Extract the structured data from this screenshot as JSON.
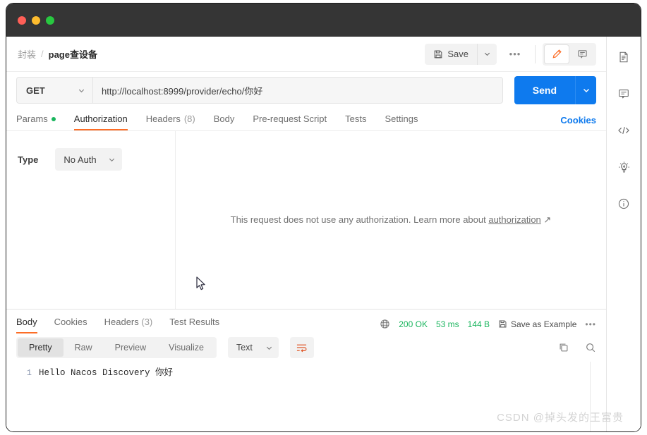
{
  "window": {
    "traffic_lights": [
      "close",
      "minimize",
      "maximize"
    ],
    "titlebar_color": "#353535"
  },
  "colors": {
    "accent_orange": "#fc6d26",
    "send_blue": "#0e7aee",
    "link_blue": "#0e7aee",
    "success_green": "#19b55d"
  },
  "breadcrumb": {
    "parent": "封装",
    "separator": "/",
    "current": "page查设备"
  },
  "header": {
    "save_label": "Save",
    "save_caret_icon": "chevron-down-icon",
    "more_label": "•••",
    "edit_icon": "pencil-icon",
    "comment_icon": "comment-icon"
  },
  "request": {
    "method": "GET",
    "method_caret_icon": "chevron-down-icon",
    "url": "http://localhost:8999/provider/echo/你好",
    "url_placeholder": "Enter request URL",
    "send_label": "Send",
    "send_caret_icon": "chevron-down-icon"
  },
  "request_tabs": [
    {
      "label": "Params",
      "dot": true,
      "active": false
    },
    {
      "label": "Authorization",
      "dot": false,
      "active": true
    },
    {
      "label": "Headers",
      "count": "(8)",
      "dot": false,
      "active": false
    },
    {
      "label": "Body",
      "dot": false,
      "active": false
    },
    {
      "label": "Pre-request Script",
      "dot": false,
      "active": false
    },
    {
      "label": "Tests",
      "dot": false,
      "active": false
    },
    {
      "label": "Settings",
      "dot": false,
      "active": false
    }
  ],
  "cookies_link": "Cookies",
  "authorization": {
    "type_label": "Type",
    "type_value": "No Auth",
    "type_caret_icon": "chevron-down-icon",
    "message_prefix": "This request does not use any authorization. Learn more about ",
    "message_link": "authorization",
    "message_link_icon": "external-link-arrow-icon"
  },
  "response": {
    "tabs": [
      {
        "label": "Body",
        "active": true
      },
      {
        "label": "Cookies",
        "active": false
      },
      {
        "label": "Headers",
        "count": "(3)",
        "active": false
      },
      {
        "label": "Test Results",
        "active": false
      }
    ],
    "globe_icon": "globe-icon",
    "status": "200 OK",
    "time": "53 ms",
    "size": "144 B",
    "save_example_label": "Save as Example",
    "save_example_icon": "save-icon",
    "more_label": "•••",
    "format_tabs": [
      {
        "label": "Pretty",
        "active": true
      },
      {
        "label": "Raw",
        "active": false
      },
      {
        "label": "Preview",
        "active": false
      },
      {
        "label": "Visualize",
        "active": false
      }
    ],
    "language": "Text",
    "language_caret_icon": "chevron-down-icon",
    "wrap_icon": "wrap-text-icon",
    "copy_icon": "copy-icon",
    "search_icon": "search-icon",
    "line_numbers": [
      "1"
    ],
    "body_lines": [
      "Hello Nacos Discovery 你好"
    ]
  },
  "right_rail": [
    {
      "name": "documentation-icon"
    },
    {
      "name": "comment-icon"
    },
    {
      "name": "code-icon"
    },
    {
      "name": "mock-lightbulb-icon"
    },
    {
      "name": "info-icon"
    }
  ],
  "watermark": "CSDN @掉头发的王富贵"
}
